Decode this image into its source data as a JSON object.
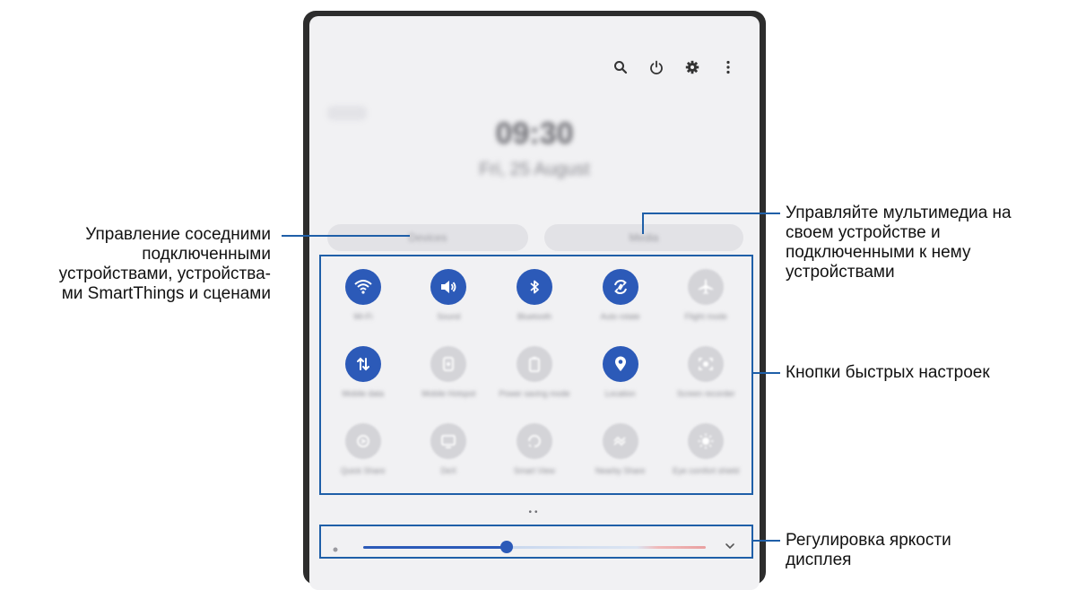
{
  "screen": {
    "clock": "09:30",
    "date": "Fri, 25 August",
    "buttons": {
      "devices": "Devices",
      "media": "Media"
    },
    "tiles": [
      {
        "label": "Wi-Fi",
        "icon": "wifi-icon",
        "active": true
      },
      {
        "label": "Sound",
        "icon": "sound-icon",
        "active": true
      },
      {
        "label": "Bluetooth",
        "icon": "bluetooth-icon",
        "active": true
      },
      {
        "label": "Auto rotate",
        "icon": "auto-rotate-icon",
        "active": true
      },
      {
        "label": "Flight mode",
        "icon": "airplane-icon",
        "active": false
      },
      {
        "label": "Mobile data",
        "icon": "mobile-data-icon",
        "active": true
      },
      {
        "label": "Mobile Hotspot",
        "icon": "hotspot-icon",
        "active": false
      },
      {
        "label": "Power saving mode",
        "icon": "battery-icon",
        "active": false
      },
      {
        "label": "Location",
        "icon": "location-icon",
        "active": true
      },
      {
        "label": "Screen recorder",
        "icon": "screen-recorder-icon",
        "active": false
      },
      {
        "label": "Quick Share",
        "icon": "quick-share-icon",
        "active": false
      },
      {
        "label": "DeX",
        "icon": "dex-icon",
        "active": false
      },
      {
        "label": "Smart View",
        "icon": "smart-view-icon",
        "active": false
      },
      {
        "label": "Nearby Share",
        "icon": "nearby-share-icon",
        "active": false
      },
      {
        "label": "Eye comfort shield",
        "icon": "eye-comfort-icon",
        "active": false
      }
    ],
    "brightness": 0.42,
    "colors": {
      "accent": "#2c5ab8",
      "callout": "#1f5fa8"
    }
  },
  "callouts": {
    "devices_line1": "Управление соседними",
    "devices_line2": "подключенными",
    "devices_line3": "устройствами, устройства-",
    "devices_line4": "ми SmartThings и сценами",
    "media_line1": "Управляйте мультимедиа на",
    "media_line2": "своем устройстве и",
    "media_line3": "подключенными к нему",
    "media_line4": "устройствами",
    "quick_settings": "Кнопки быстрых настроек",
    "brightness_line1": "Регулировка яркости",
    "brightness_line2": "дисплея"
  }
}
